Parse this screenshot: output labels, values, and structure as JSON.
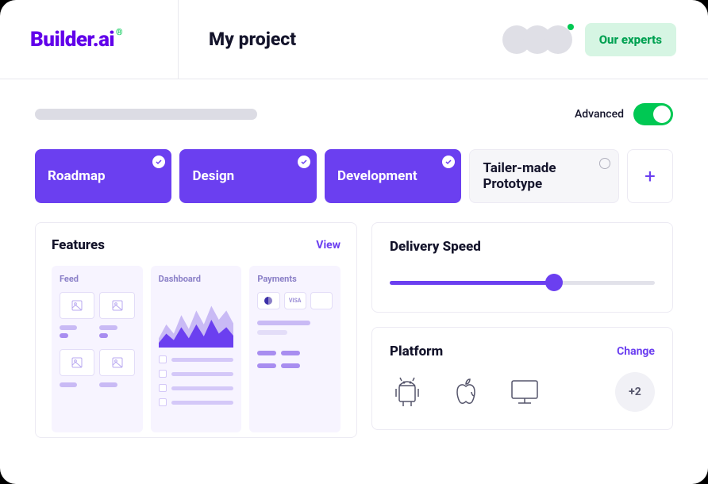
{
  "header": {
    "logo_text": "Builder.ai",
    "logo_mark": "®",
    "title": "My project",
    "experts_button": "Our experts"
  },
  "toolbar": {
    "advanced_label": "Advanced",
    "advanced_on": true
  },
  "phases": [
    {
      "label": "Roadmap",
      "selected": true
    },
    {
      "label": "Design",
      "selected": true
    },
    {
      "label": "Development",
      "selected": true
    },
    {
      "label": "Tailer-made Prototype",
      "selected": false
    }
  ],
  "features": {
    "title": "Features",
    "view_label": "View",
    "cards": [
      {
        "title": "Feed"
      },
      {
        "title": "Dashboard"
      },
      {
        "title": "Payments",
        "chips": [
          "",
          "VISA",
          ""
        ]
      }
    ]
  },
  "delivery": {
    "title": "Delivery Speed",
    "value_percent": 62
  },
  "platform": {
    "title": "Platform",
    "change_label": "Change",
    "icons": [
      "android",
      "apple",
      "desktop"
    ],
    "more_label": "+2"
  }
}
